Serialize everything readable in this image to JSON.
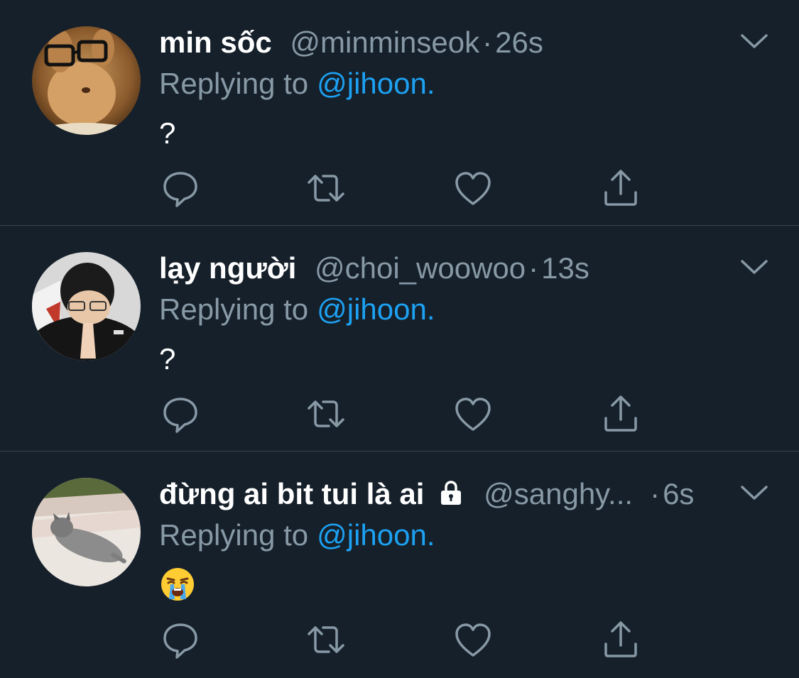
{
  "tweets": [
    {
      "name": "min sốc",
      "handle": "@minminseok",
      "time": "26s",
      "protected": false,
      "replying_prefix": "Replying to",
      "replying_to": "@jihoon.",
      "text": "?",
      "avatar_icon": "glasses-bunny-avatar"
    },
    {
      "name": "lạy người",
      "handle": "@choi_woowoo",
      "time": "13s",
      "protected": false,
      "replying_prefix": "Replying to",
      "replying_to": "@jihoon.",
      "text": "?",
      "avatar_icon": "praying-person-avatar"
    },
    {
      "name": "đừng ai bit tui là ai",
      "handle": "@sanghy...",
      "time": "6s",
      "protected": true,
      "replying_prefix": "Replying to",
      "replying_to": "@jihoon.",
      "text": "",
      "emoji": "loudly-crying-face",
      "avatar_icon": "sleeping-kitten-avatar"
    }
  ],
  "separator": "·",
  "icons": {
    "reply": "reply-icon",
    "retweet": "retweet-icon",
    "like": "heart-icon",
    "share": "share-icon",
    "more": "chevron-down-icon",
    "lock": "lock-icon"
  },
  "colors": {
    "background": "#15202b",
    "divider": "#38444d",
    "secondary_text": "#8899a6",
    "link": "#1da1f2",
    "primary_text": "#ffffff"
  }
}
